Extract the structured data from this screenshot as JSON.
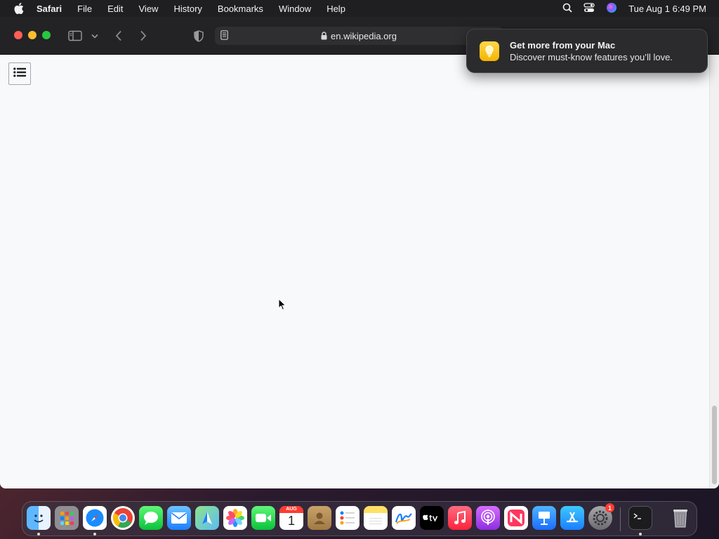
{
  "menubar": {
    "app_name": "Safari",
    "items": [
      "File",
      "Edit",
      "View",
      "History",
      "Bookmarks",
      "Window",
      "Help"
    ],
    "clock": "Tue Aug 1  6:49 PM"
  },
  "browser": {
    "url": "en.wikipedia.org"
  },
  "notification": {
    "title": "Get more from your Mac",
    "body": "Discover must-know features you’ll love."
  },
  "dock": {
    "calendar_month": "AUG",
    "calendar_day": "1",
    "settings_badge": "1",
    "apps": [
      "Finder",
      "Launchpad",
      "Safari",
      "Google Chrome",
      "Messages",
      "Mail",
      "Maps",
      "Photos",
      "FaceTime",
      "Calendar",
      "Contacts",
      "Reminders",
      "Notes",
      "Freeform",
      "TV",
      "Music",
      "Podcasts",
      "News",
      "Keynote",
      "App Store",
      "System Settings",
      "Terminal",
      "Trash"
    ]
  },
  "colors": {
    "menubar": "#1f1f21",
    "toolbar": "#232325",
    "page_background": "#f8f9fa",
    "close": "#ff5f57",
    "minimize": "#febc2e",
    "maximize": "#28c840"
  }
}
